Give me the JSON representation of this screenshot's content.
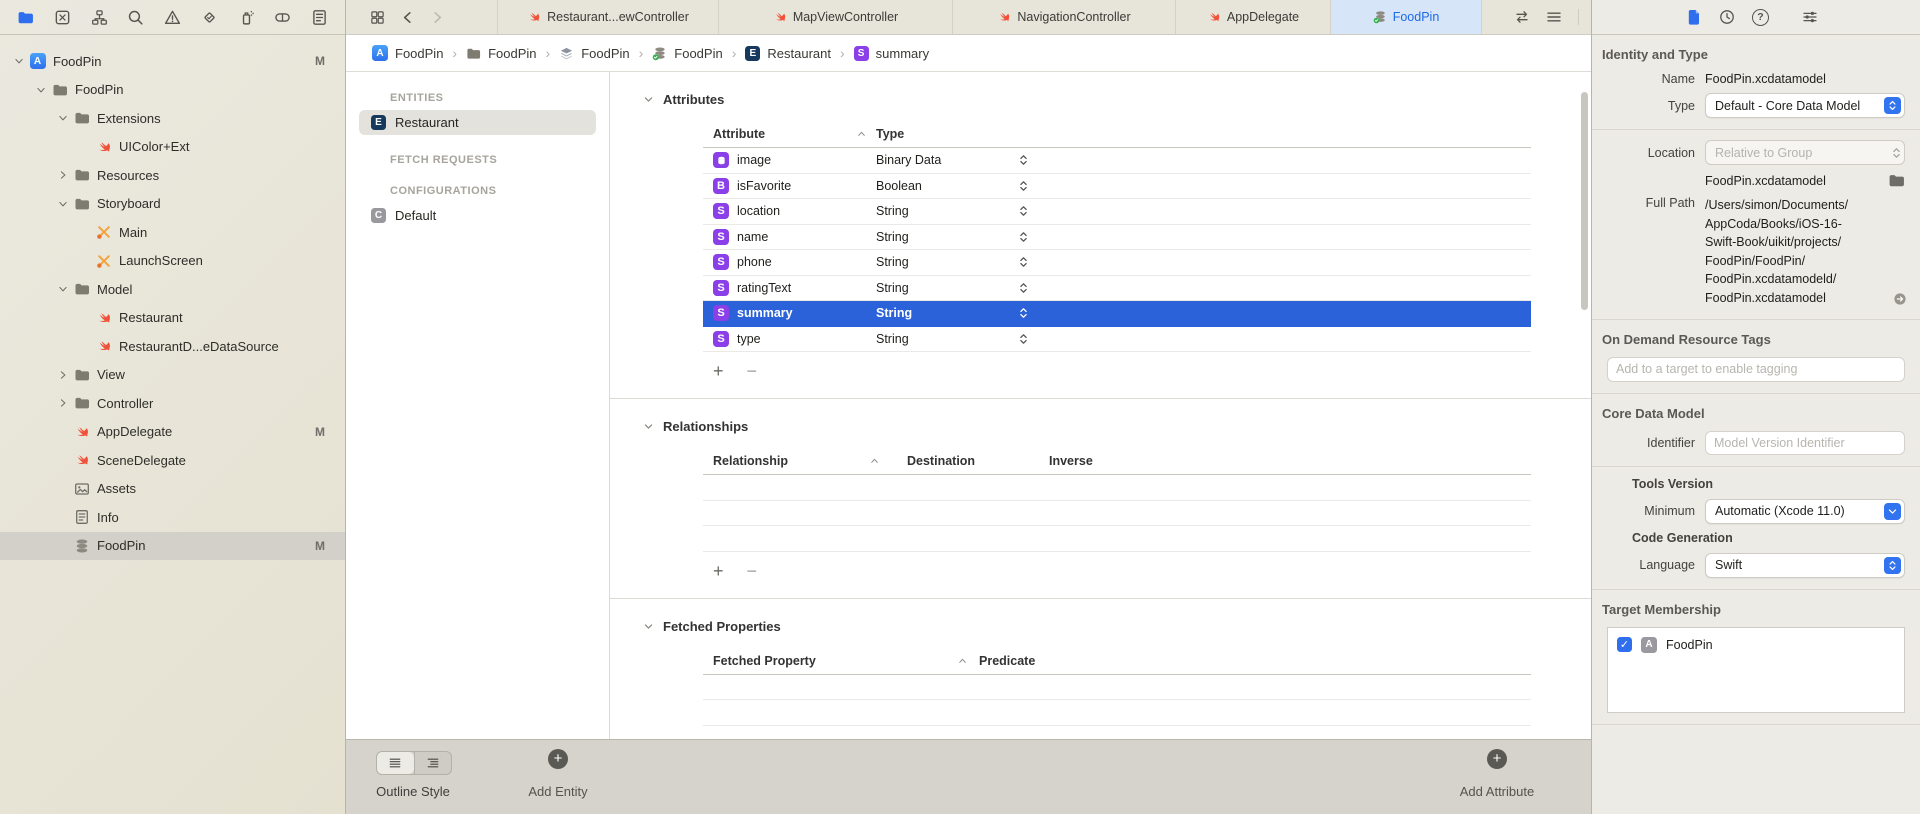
{
  "colors": {
    "accent": "#2f6fed",
    "selection_blue": "#2c62d9",
    "attribute_purple": "#8a3fe8",
    "entity_navy": "#17395e",
    "swift_orange": "#f05138",
    "active_tab_bg": "#d7e5f8",
    "active_tab_text": "#1d6ae5",
    "navigator_bg": "#e9e6db",
    "inspector_bg": "#edebe5",
    "bottombar_bg": "#d6d3cd",
    "green_check": "#35b14e"
  },
  "navigator": {
    "toolbar_icons": [
      "project-navigator",
      "source-control-navigator",
      "symbol-navigator",
      "find-navigator",
      "issue-navigator",
      "test-navigator",
      "debug-navigator",
      "breakpoint-navigator",
      "report-navigator"
    ],
    "tree": [
      {
        "label": "FoodPin",
        "depth": 0,
        "icon": "app",
        "chevron": "open",
        "badge": "M"
      },
      {
        "label": "FoodPin",
        "depth": 1,
        "icon": "folder",
        "chevron": "open"
      },
      {
        "label": "Extensions",
        "depth": 2,
        "icon": "folder",
        "chevron": "open"
      },
      {
        "label": "UIColor+Ext",
        "depth": 3,
        "icon": "swift"
      },
      {
        "label": "Resources",
        "depth": 2,
        "icon": "folder",
        "chevron": "closed"
      },
      {
        "label": "Storyboard",
        "depth": 2,
        "icon": "folder",
        "chevron": "open"
      },
      {
        "label": "Main",
        "depth": 3,
        "icon": "storyboard"
      },
      {
        "label": "LaunchScreen",
        "depth": 3,
        "icon": "storyboard"
      },
      {
        "label": "Model",
        "depth": 2,
        "icon": "folder",
        "chevron": "open"
      },
      {
        "label": "Restaurant",
        "depth": 3,
        "icon": "swift"
      },
      {
        "label": "RestaurantD...eDataSource",
        "depth": 3,
        "icon": "swift"
      },
      {
        "label": "View",
        "depth": 2,
        "icon": "folder",
        "chevron": "closed"
      },
      {
        "label": "Controller",
        "depth": 2,
        "icon": "folder",
        "chevron": "closed"
      },
      {
        "label": "AppDelegate",
        "depth": 2,
        "icon": "swift",
        "badge": "M"
      },
      {
        "label": "SceneDelegate",
        "depth": 2,
        "icon": "swift"
      },
      {
        "label": "Assets",
        "depth": 2,
        "icon": "assets"
      },
      {
        "label": "Info",
        "depth": 2,
        "icon": "plist"
      },
      {
        "label": "FoodPin",
        "depth": 2,
        "icon": "datamodel",
        "badge": "M",
        "selected": true
      }
    ]
  },
  "tabbar": {
    "tabs": [
      {
        "label": "Restaurant...ewController",
        "icon": "swift"
      },
      {
        "label": "MapViewController",
        "icon": "swift"
      },
      {
        "label": "NavigationController",
        "icon": "swift"
      },
      {
        "label": "AppDelegate",
        "icon": "swift"
      },
      {
        "label": "FoodPin",
        "icon": "datamodel",
        "active": true
      }
    ]
  },
  "breadcrumb": {
    "items": [
      {
        "label": "FoodPin",
        "icon": "app"
      },
      {
        "label": "FoodPin",
        "icon": "folder"
      },
      {
        "label": "FoodPin",
        "icon": "group-stack"
      },
      {
        "label": "FoodPin",
        "icon": "datamodel"
      },
      {
        "label": "Restaurant",
        "icon": "entity-badge"
      },
      {
        "label": "summary",
        "icon": "attribute-badge"
      }
    ]
  },
  "entities_panel": {
    "sections": [
      {
        "header": "ENTITIES",
        "items": [
          {
            "label": "Restaurant",
            "badge": "E",
            "selected": true
          }
        ]
      },
      {
        "header": "FETCH REQUESTS",
        "items": []
      },
      {
        "header": "CONFIGURATIONS",
        "items": [
          {
            "label": "Default",
            "badge": "C"
          }
        ]
      }
    ]
  },
  "editor": {
    "attributes": {
      "title": "Attributes",
      "col_attribute": "Attribute",
      "col_type": "Type",
      "rows": [
        {
          "name": "image",
          "type": "Binary Data",
          "badge": "binary"
        },
        {
          "name": "isFavorite",
          "type": "Boolean",
          "badge": "B"
        },
        {
          "name": "location",
          "type": "String",
          "badge": "S"
        },
        {
          "name": "name",
          "type": "String",
          "badge": "S"
        },
        {
          "name": "phone",
          "type": "String",
          "badge": "S"
        },
        {
          "name": "ratingText",
          "type": "String",
          "badge": "S"
        },
        {
          "name": "summary",
          "type": "String",
          "badge": "S",
          "selected": true
        },
        {
          "name": "type",
          "type": "String",
          "badge": "S"
        }
      ]
    },
    "relationships": {
      "title": "Relationships",
      "col_relationship": "Relationship",
      "col_destination": "Destination",
      "col_inverse": "Inverse",
      "rows": []
    },
    "fetched_properties": {
      "title": "Fetched Properties",
      "col_fetched_property": "Fetched Property",
      "col_predicate": "Predicate",
      "rows": []
    }
  },
  "bottombar": {
    "outline_style_label": "Outline Style",
    "add_entity_label": "Add Entity",
    "add_attribute_label": "Add Attribute"
  },
  "inspector": {
    "toolbar_icons": [
      "file-inspector",
      "history-inspector",
      "help-inspector",
      "attributes-inspector"
    ],
    "identity": {
      "title": "Identity and Type",
      "name_label": "Name",
      "name_value": "FoodPin.xcdatamodel",
      "type_label": "Type",
      "type_value": "Default - Core Data Model",
      "location_label": "Location",
      "location_value": "Relative to Group",
      "file_name": "FoodPin.xcdatamodel",
      "full_path_label": "Full Path",
      "full_path_lines": [
        "/Users/simon/Documents/",
        "AppCoda/Books/iOS-16-",
        "Swift-Book/uikit/projects/",
        "FoodPin/FoodPin/",
        "FoodPin.xcdatamodeld/",
        "FoodPin.xcdatamodel"
      ]
    },
    "on_demand": {
      "title": "On Demand Resource Tags",
      "placeholder": "Add to a target to enable tagging"
    },
    "core_data_model": {
      "title": "Core Data Model",
      "identifier_label": "Identifier",
      "identifier_placeholder": "Model Version Identifier",
      "tools_version_title": "Tools Version",
      "minimum_label": "Minimum",
      "minimum_value": "Automatic (Xcode 11.0)",
      "code_generation_title": "Code Generation",
      "language_label": "Language",
      "language_value": "Swift"
    },
    "target_membership": {
      "title": "Target Membership",
      "targets": [
        {
          "label": "FoodPin",
          "checked": true
        }
      ]
    }
  }
}
